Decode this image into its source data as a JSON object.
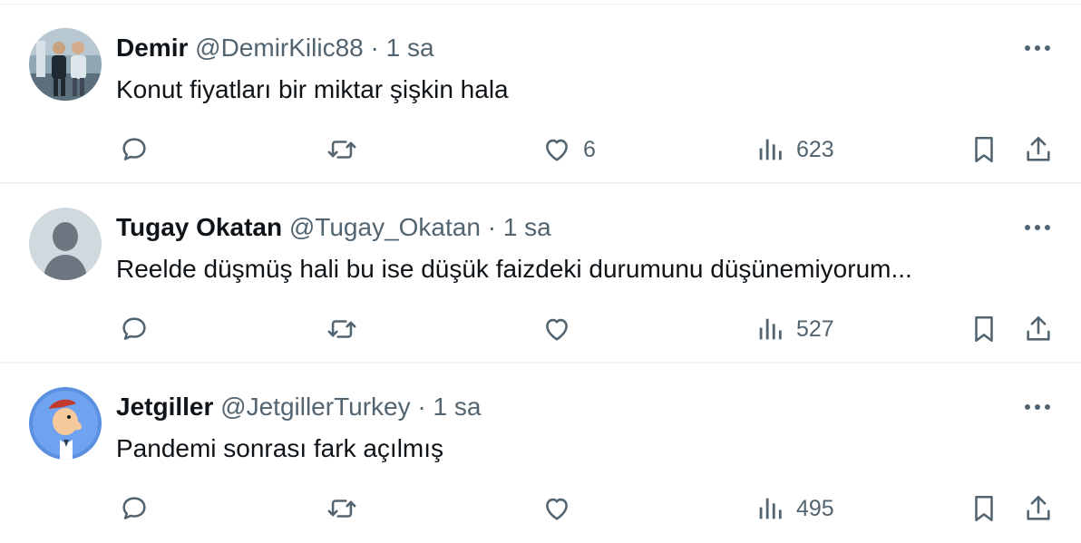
{
  "tweets": [
    {
      "name": "Demir",
      "handle": "@DemirKilic88",
      "dot": "·",
      "time": "1 sa",
      "text": "Konut fiyatları bir miktar şişkin hala",
      "likes": "6",
      "views": "623",
      "avatar": "photo-two-men"
    },
    {
      "name": "Tugay Okatan",
      "handle": "@Tugay_Okatan",
      "dot": "·",
      "time": "1 sa",
      "text": "Reelde düşmüş hali bu ise düşük faizdeki durumunu düşünemiyorum...",
      "likes": "",
      "views": "527",
      "avatar": "default-profile"
    },
    {
      "name": "Jetgiller",
      "handle": "@JetgillerTurkey",
      "dot": "·",
      "time": "1 sa",
      "text": "Pandemi sonrası fark açılmış",
      "likes": "",
      "views": "495",
      "avatar": "cartoon-character"
    }
  ],
  "icons": [
    "more-icon",
    "reply-icon",
    "retweet-icon",
    "like-icon",
    "views-icon",
    "bookmark-icon",
    "share-icon"
  ],
  "colors": {
    "text": "#0f1419",
    "secondary": "#536471",
    "divider": "#eff3f4"
  }
}
